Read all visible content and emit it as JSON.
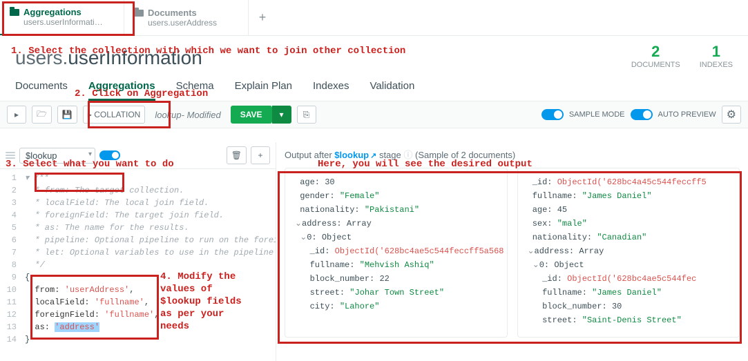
{
  "tabs": {
    "active": {
      "title": "Aggregations",
      "subtitle": "users.userInformati…"
    },
    "inactive": {
      "title": "Documents",
      "subtitle": "users.userAddress"
    }
  },
  "annotations": {
    "step1": "1. Select the collection with which we want to join other collection",
    "step2": "2. Click on Aggregation",
    "step3": "3. Select what you want to do",
    "step4_l1": "4. Modify the",
    "step4_l2": "values of",
    "step4_l3": "$lookup fields",
    "step4_l4": "as per your",
    "step4_l5": "needs",
    "output": "Here, you will see the desired output"
  },
  "title": {
    "db": "users",
    "coll": "userInformation"
  },
  "stats": {
    "documents": {
      "num": "2",
      "label": "DOCUMENTS"
    },
    "indexes": {
      "num": "1",
      "label": "INDEXES"
    }
  },
  "subtabs": [
    "Documents",
    "Aggregations",
    "Schema",
    "Explain Plan",
    "Indexes",
    "Validation"
  ],
  "toolbar": {
    "collation": "▸ COLLATION",
    "pipeline_name": "lookup",
    "modified": "- Modified",
    "save": "SAVE",
    "sample": "SAMPLE MODE",
    "auto": "AUTO PREVIEW"
  },
  "stage": {
    "operator": "$lookup"
  },
  "code": {
    "l1": "/**",
    "l2": " * from: The target collection.",
    "l3": " * localField: The local join field.",
    "l4": " * foreignField: The target join field.",
    "l5": " * as: The name for the results.",
    "l6": " * pipeline: Optional pipeline to run on the foreign co",
    "l7": " * let: Optional variables to use in the pipeline field",
    "l8": " */",
    "body": {
      "from_key": "from:",
      "from_val": "'userAddress'",
      "local_key": "localField:",
      "local_val": "'fullname'",
      "foreign_key": "foreignField:",
      "foreign_val": "'fullname'",
      "as_key": "as:",
      "as_val": "'address'"
    }
  },
  "output": {
    "head_pre": "Output after ",
    "op": "$lookup",
    "head_post": " stage ",
    "sample": "(Sample of 2 documents)"
  },
  "doc1": {
    "age_k": "age:",
    "age_v": "30",
    "gender_k": "gender:",
    "gender_v": "Female",
    "nat_k": "nationality:",
    "nat_v": "Pakistani",
    "addr_k": "address:",
    "addr_t": "Array",
    "idx": "0:",
    "idx_t": "Object",
    "id_k": "_id:",
    "id_v": "ObjectId('628bc4ae5c544feccff5a568",
    "fn_k": "fullname:",
    "fn_v": "Mehvish Ashiq",
    "bn_k": "block_number:",
    "bn_v": "22",
    "st_k": "street:",
    "st_v": "Johar Town Street",
    "ct_k": "city:",
    "ct_v": "Lahore"
  },
  "doc2": {
    "id0_k": "_id:",
    "id0_v": "ObjectId('628bc4a45c544feccff5",
    "fn0_k": "fullname:",
    "fn0_v": "James Daniel",
    "age_k": "age:",
    "age_v": "45",
    "sex_k": "sex:",
    "sex_v": "male",
    "nat_k": "nationality:",
    "nat_v": "Canadian",
    "addr_k": "address:",
    "addr_t": "Array",
    "idx": "0:",
    "idx_t": "Object",
    "id_k": "_id:",
    "id_v": "ObjectId('628bc4ae5c544fec",
    "fn_k": "fullname:",
    "fn_v": "James Daniel",
    "bn_k": "block_number:",
    "bn_v": "30",
    "st_k": "street:",
    "st_v": "Saint-Denis Street"
  }
}
